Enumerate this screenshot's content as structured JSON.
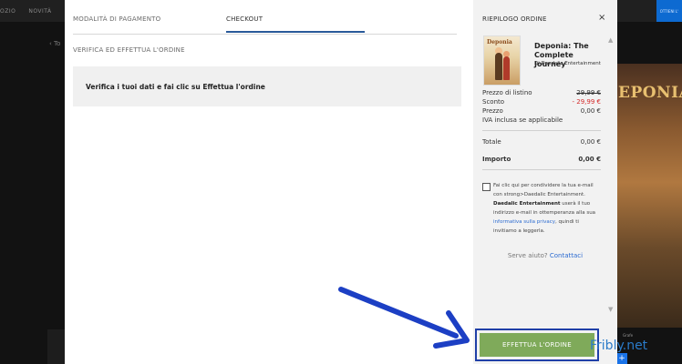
{
  "background": {
    "nav_items": [
      "ozio",
      "Novità",
      "D"
    ],
    "back_text": "‹ To",
    "hero_title": "EPONIA",
    "small_text": "Grafe",
    "plus": "+",
    "top_right_label": "OTTIENI L'"
  },
  "tabs": {
    "payment": "MODALITÀ DI PAGAMENTO",
    "checkout": "CHECKOUT"
  },
  "main": {
    "section_title": "VERIFICA ED EFFETTUA L'ORDINE",
    "verify_text": "Verifica i tuoi dati e fai clic su Effettua l'ordine"
  },
  "summary": {
    "title": "RIEPILOGO ORDINE",
    "close": "×",
    "cover_logo": "Deponia",
    "game_title": "Deponia: The Complete Journey",
    "developer": "Di Daedalic Entertainment",
    "list_price_label": "Prezzo di listino",
    "list_price": "29,99 €",
    "discount_label": "Sconto",
    "discount": "- 29,99 €",
    "price_label": "Prezzo",
    "price": "0,00 €",
    "vat_note": "IVA inclusa se applicabile",
    "total_label": "Totale",
    "total": "0,00 €",
    "amount_label": "Importo",
    "amount": "0,00 €",
    "consent_part1": "Fai clic qui per condividere la tua e-mail con strong>Daedalic Entertainment. ",
    "consent_bold": "Daedalic Entertainment",
    "consent_part2": " userà il tuo indirizzo e-mail in ottemperanza alla sua ",
    "consent_link": "informativa sulla privacy",
    "consent_part3": ", quindi ti invitiamo a leggerla.",
    "help_text": "Serve aiuto?",
    "help_link": "Contattaci",
    "cta": "EFFETTUA L'ORDINE"
  },
  "watermark": "Fribly.net",
  "colors": {
    "cta": "#7faa5a",
    "cta_frame": "#2040a8",
    "arrow": "#1c3fc4",
    "tab_underline": "#2a5a9a",
    "discount": "#d42a2a",
    "link": "#2a6ad0"
  }
}
